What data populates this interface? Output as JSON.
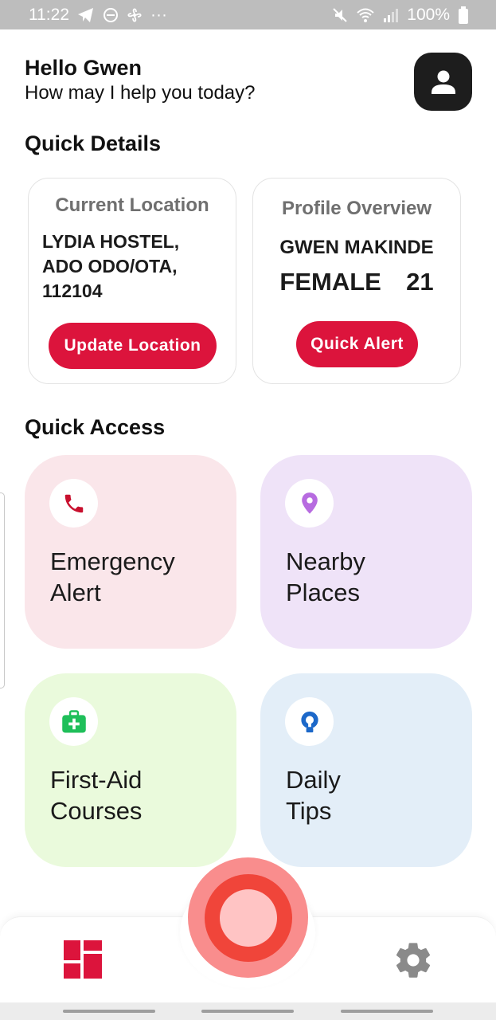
{
  "status_bar": {
    "time": "11:22",
    "more": "···",
    "battery": "100%",
    "icons_left": [
      "telegram-icon",
      "do-not-disturb-icon",
      "fan-icon"
    ],
    "icons_right": [
      "mute-icon",
      "wifi-icon",
      "signal-icon",
      "battery-icon"
    ]
  },
  "header": {
    "greeting": "Hello Gwen",
    "subtitle": "How may I help you today?"
  },
  "quick_details": {
    "title": "Quick Details",
    "location_card": {
      "heading": "Current Location",
      "address": [
        "LYDIA HOSTEL,",
        "ADO ODO/OTA,",
        "112104"
      ],
      "button": "Update Location"
    },
    "profile_card": {
      "heading": "Profile Overview",
      "name": "GWEN MAKINDE",
      "gender": "FEMALE",
      "age": "21",
      "button": "Quick Alert"
    }
  },
  "quick_access": {
    "title": "Quick Access",
    "tiles": [
      {
        "line1": "Emergency",
        "line2": "Alert",
        "icon": "phone-icon",
        "bg": "#fae6ea",
        "icon_color": "#c8102e"
      },
      {
        "line1": "Nearby",
        "line2": "Places",
        "icon": "location-pin-icon",
        "bg": "#efe3f8",
        "icon_color": "#b76be0"
      },
      {
        "line1": "First-Aid",
        "line2": "Courses",
        "icon": "first-aid-kit-icon",
        "bg": "#eafadc",
        "icon_color": "#1fbf5a"
      },
      {
        "line1": "Daily",
        "line2": "Tips",
        "icon": "lightbulb-icon",
        "bg": "#e3eef8",
        "icon_color": "#1c68c9"
      }
    ]
  },
  "colors": {
    "accent": "#dc143c",
    "sos_outer": "#f98d8d",
    "sos_mid": "#f0453a",
    "sos_inner": "#ffc4c4"
  }
}
